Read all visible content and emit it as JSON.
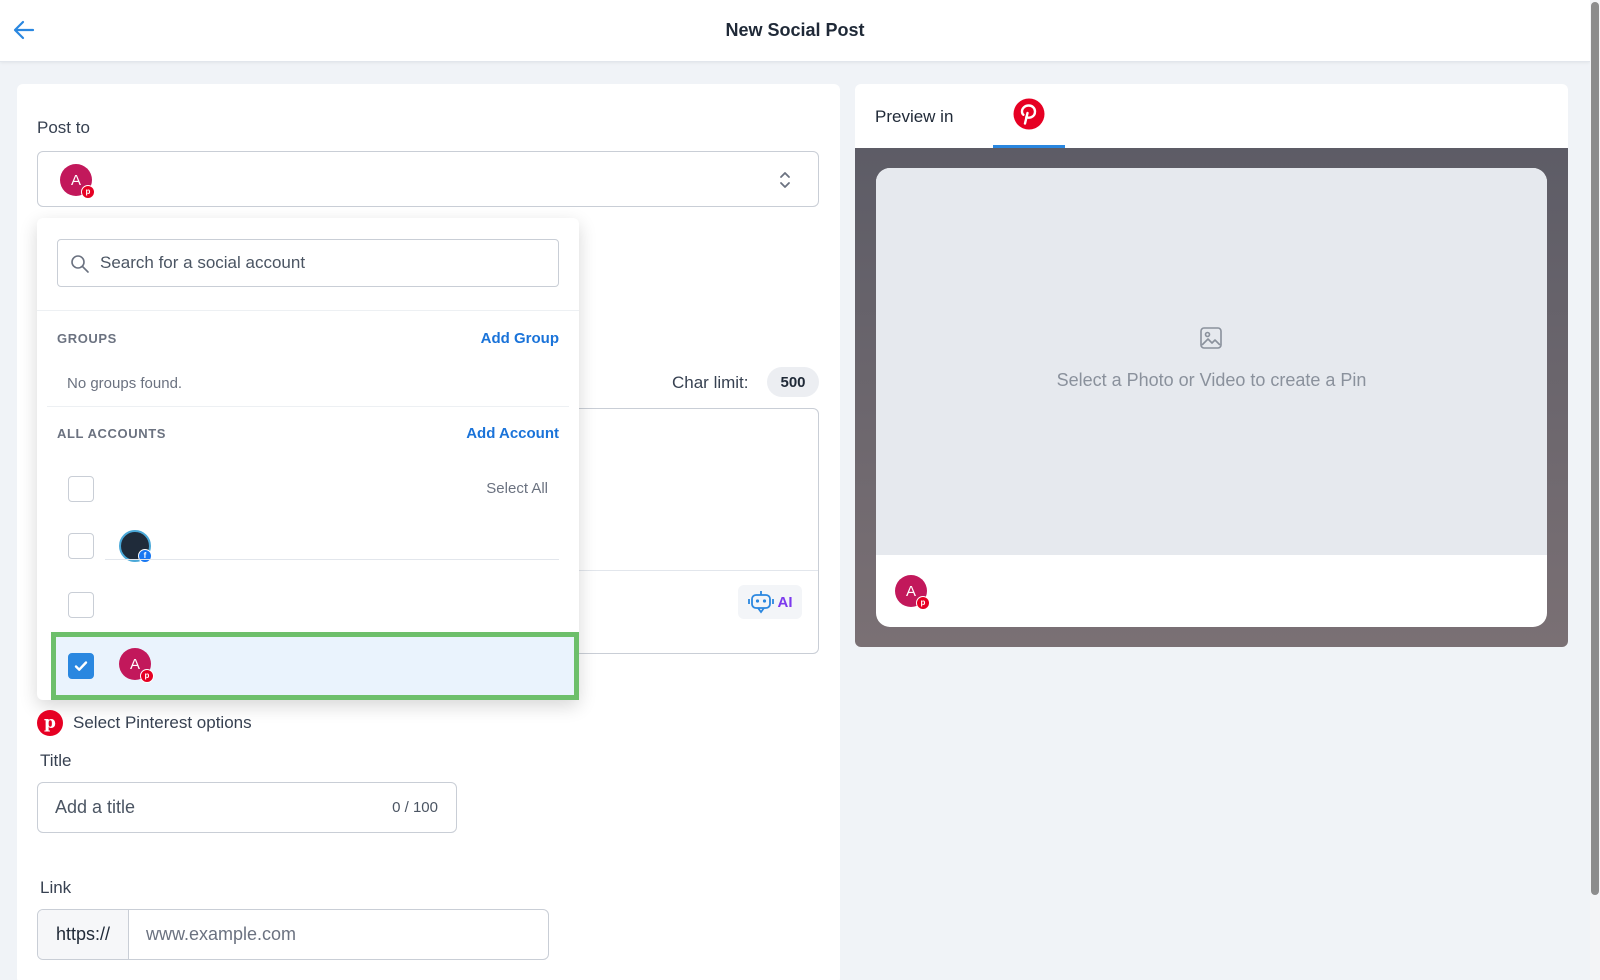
{
  "header": {
    "title": "New Social Post"
  },
  "compose": {
    "post_to_label": "Post to",
    "selected_account_initial": "A",
    "char_limit_label": "Char limit:",
    "char_limit_value": "500",
    "ai_label": "AI"
  },
  "dropdown": {
    "search_placeholder": "Search for a social account",
    "groups_heading": "GROUPS",
    "add_group_label": "Add Group",
    "no_groups_text": "No groups found.",
    "accounts_heading": "ALL ACCOUNTS",
    "add_account_label": "Add Account",
    "select_all_label": "Select All",
    "accounts": [
      {
        "initial": "",
        "network": "facebook",
        "checked": false
      },
      {
        "initial": "",
        "network": "",
        "checked": false
      },
      {
        "initial": "A",
        "network": "pinterest",
        "checked": true
      }
    ]
  },
  "pinterest_options": {
    "heading": "Select Pinterest options",
    "title_label": "Title",
    "title_placeholder": "Add a title",
    "title_counter": "0 / 100",
    "link_label": "Link",
    "link_prefix": "https://",
    "link_placeholder": "www.example.com"
  },
  "preview": {
    "label": "Preview in",
    "media_prompt": "Select a Photo or Video to create a Pin",
    "avatar_initial": "A"
  },
  "colors": {
    "accent": "#2a87e0",
    "pinterest": "#e60023",
    "facebook": "#1877f2",
    "highlight": "#6dbf6b",
    "ai": "#7c3aed"
  }
}
